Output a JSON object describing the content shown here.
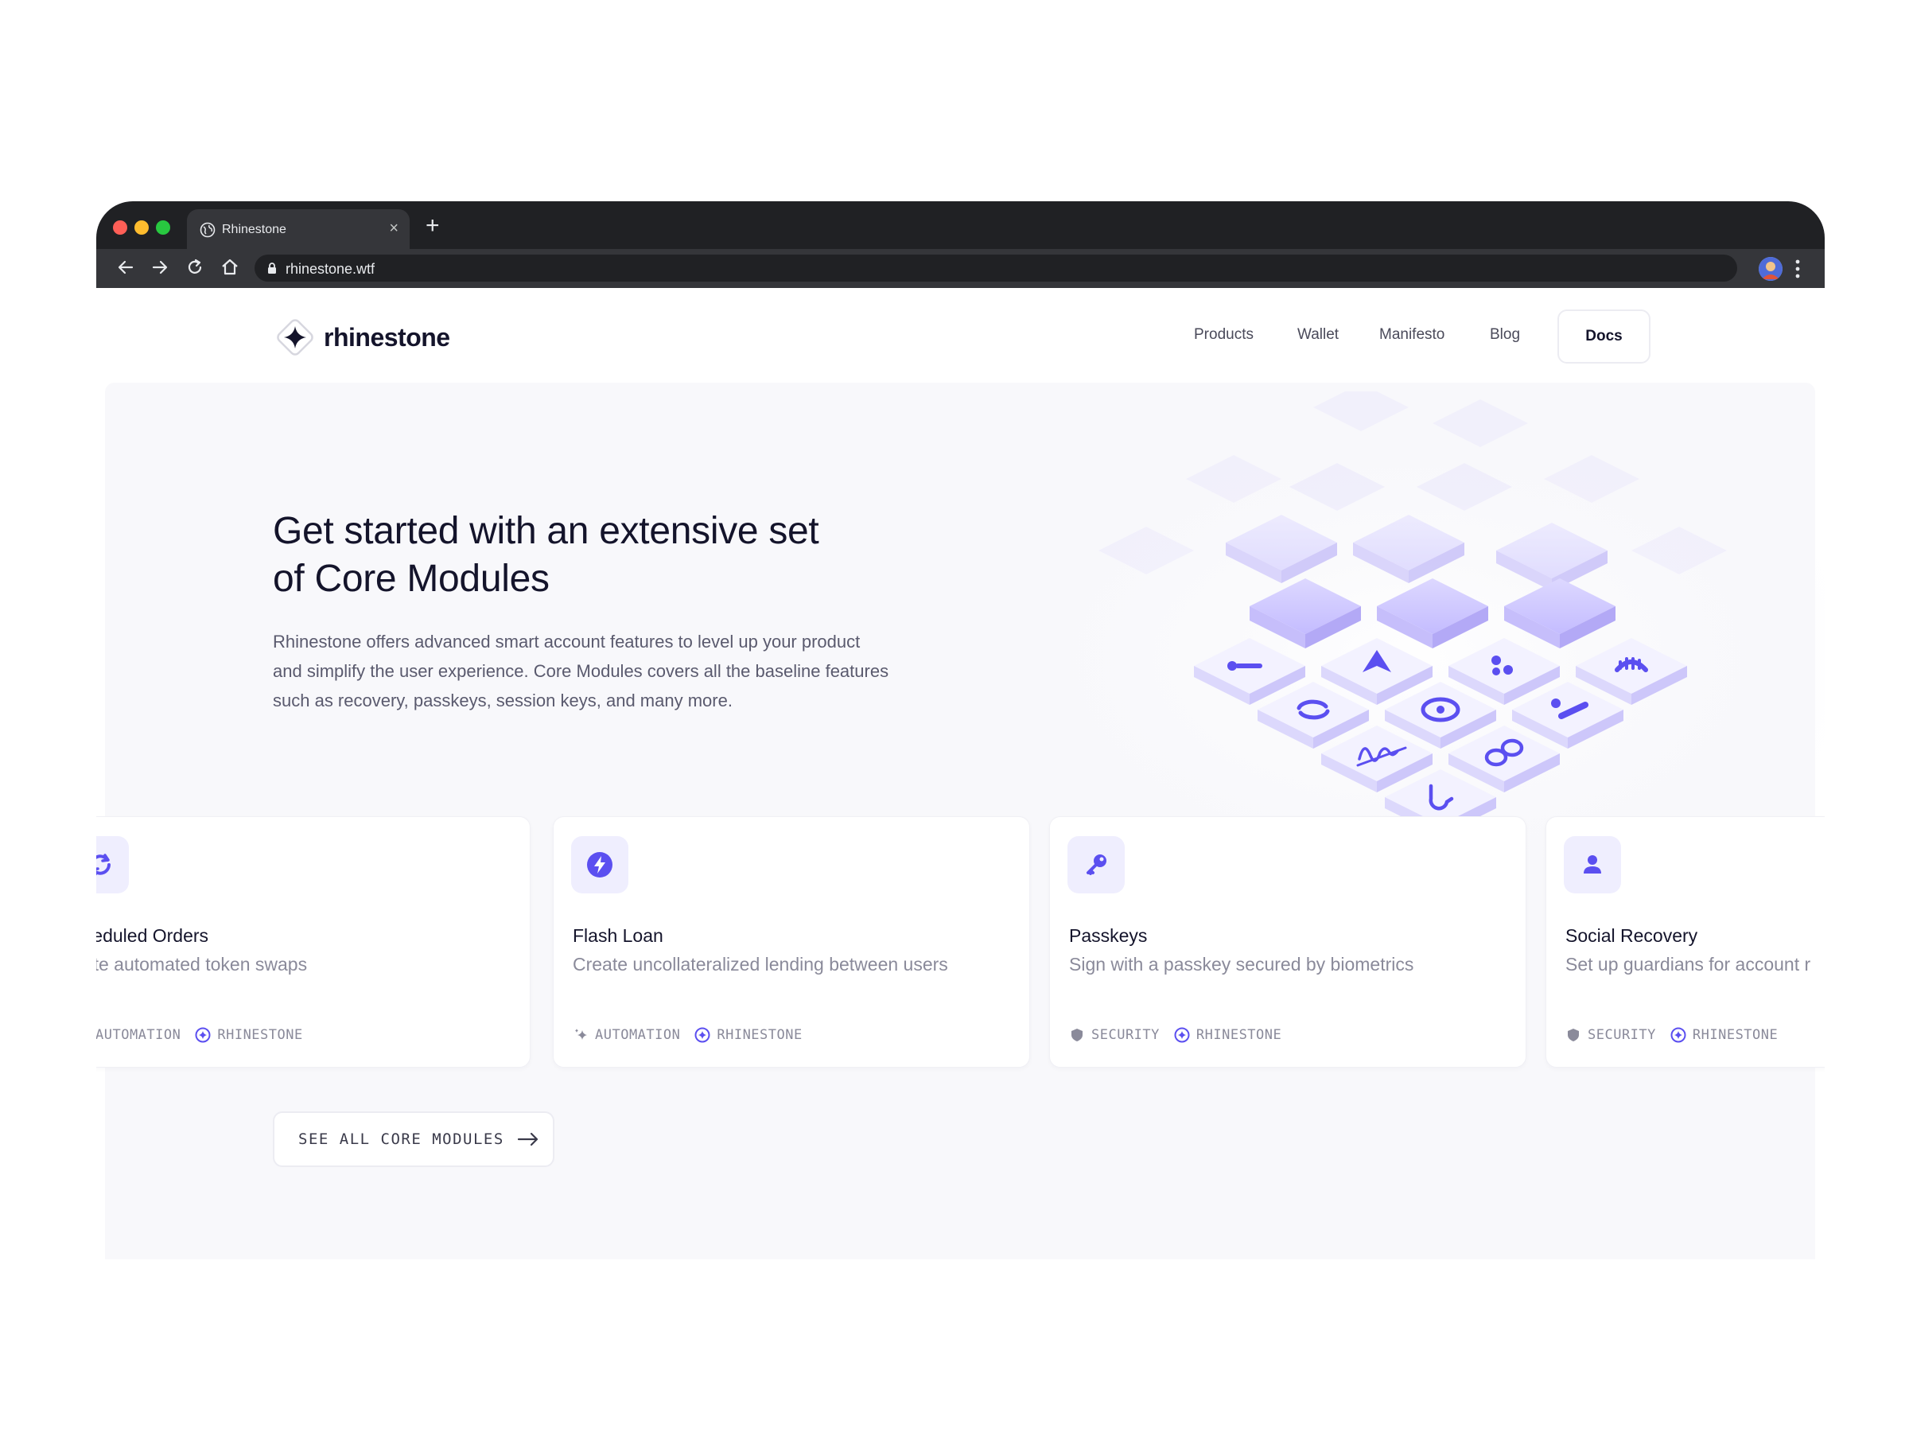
{
  "browser": {
    "tab_title": "Rhinestone",
    "tab_close": "×",
    "new_tab": "+",
    "url": "rhinestone.wtf"
  },
  "site": {
    "logo_text": "rhinestone",
    "nav": {
      "products": "Products",
      "wallet": "Wallet",
      "manifesto": "Manifesto",
      "blog": "Blog",
      "docs": "Docs"
    }
  },
  "hero": {
    "title_line1": "Get started with an extensive set",
    "title_line2": "of Core Modules",
    "desc_line1": "Rhinestone offers advanced smart account features to level up your product",
    "desc_line2": "and simplify the user experience. Core Modules covers all the baseline features",
    "desc_line3": "such as recovery, passkeys, session keys, and many more."
  },
  "cards": [
    {
      "title": "cheduled Orders",
      "subtitle": "eate automated token swaps",
      "tag1": "AUTOMATION",
      "tag2": "RHINESTONE",
      "icon": "refresh-icon"
    },
    {
      "title": "Flash Loan",
      "subtitle": "Create uncollateralized lending between users",
      "tag1": "AUTOMATION",
      "tag2": "RHINESTONE",
      "icon": "lightning-icon"
    },
    {
      "title": "Passkeys",
      "subtitle": "Sign with a passkey secured by biometrics",
      "tag1": "SECURITY",
      "tag2": "RHINESTONE",
      "icon": "key-icon"
    },
    {
      "title": "Social Recovery",
      "subtitle": "Set up guardians for account r",
      "tag1": "SECURITY",
      "tag2": "RHINESTONE",
      "icon": "user-icon"
    }
  ],
  "cta": {
    "see_all": "SEE ALL CORE MODULES"
  },
  "colors": {
    "accent": "#5b4ff0",
    "accent_light": "#efeefe",
    "heading": "#14142b",
    "muted": "#8a8a9a",
    "browser_dark": "#202124"
  }
}
